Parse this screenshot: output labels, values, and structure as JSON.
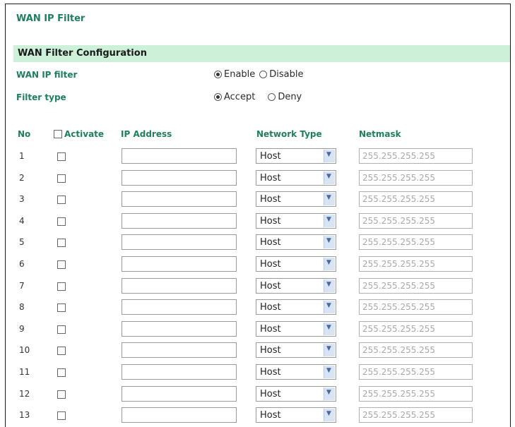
{
  "page": {
    "title": "WAN IP Filter"
  },
  "section": {
    "title": "WAN Filter Configuration"
  },
  "wan_ip_filter": {
    "label": "WAN IP filter",
    "options": [
      "Enable",
      "Disable"
    ],
    "selected": "Enable"
  },
  "filter_type": {
    "label": "Filter type",
    "options": [
      "Accept",
      "Deny"
    ],
    "selected": "Accept"
  },
  "table": {
    "headers": {
      "no": "No",
      "activate": "Activate",
      "ip": "IP Address",
      "network_type": "Network Type",
      "netmask": "Netmask"
    },
    "rows": [
      {
        "no": "1",
        "network_type": "Host",
        "netmask_placeholder": "255.255.255.255"
      },
      {
        "no": "2",
        "network_type": "Host",
        "netmask_placeholder": "255.255.255.255"
      },
      {
        "no": "3",
        "network_type": "Host",
        "netmask_placeholder": "255.255.255.255"
      },
      {
        "no": "4",
        "network_type": "Host",
        "netmask_placeholder": "255.255.255.255"
      },
      {
        "no": "5",
        "network_type": "Host",
        "netmask_placeholder": "255.255.255.255"
      },
      {
        "no": "6",
        "network_type": "Host",
        "netmask_placeholder": "255.255.255.255"
      },
      {
        "no": "7",
        "network_type": "Host",
        "netmask_placeholder": "255.255.255.255"
      },
      {
        "no": "8",
        "network_type": "Host",
        "netmask_placeholder": "255.255.255.255"
      },
      {
        "no": "9",
        "network_type": "Host",
        "netmask_placeholder": "255.255.255.255"
      },
      {
        "no": "10",
        "network_type": "Host",
        "netmask_placeholder": "255.255.255.255"
      },
      {
        "no": "11",
        "network_type": "Host",
        "netmask_placeholder": "255.255.255.255"
      },
      {
        "no": "12",
        "network_type": "Host",
        "netmask_placeholder": "255.255.255.255"
      },
      {
        "no": "13",
        "network_type": "Host",
        "netmask_placeholder": "255.255.255.255"
      }
    ]
  },
  "colors": {
    "accent": "#1f7f5c",
    "section_bg": "#ccf0d8"
  },
  "icons": {
    "select_arrow": "chevron-down-icon"
  }
}
